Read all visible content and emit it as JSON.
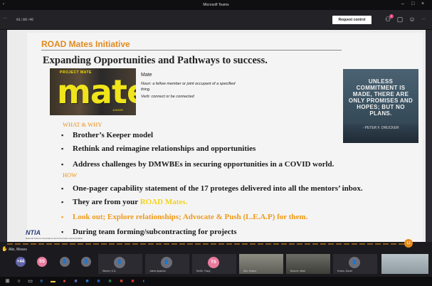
{
  "window": {
    "title": "Microsoft Teams"
  },
  "toolbar": {
    "timer": "01:06:46",
    "request_control": "Request control",
    "badge": "2",
    "more": "···"
  },
  "slide": {
    "header": "ROAD Mates Initiative",
    "heading": "Expanding Opportunities and Pathways to success.",
    "mate_image": {
      "top_text": "PROJECT MATE",
      "word": "mate",
      "bottom_text": "JUNIOR"
    },
    "definition": {
      "term": "Mate",
      "noun": "Noun: a fellow member or joint occupant of a specified thing.",
      "verb": "Verb: connect or be connected"
    },
    "quote": {
      "text": "UNLESS COMMITMENT IS MADE, THERE ARE ONLY PROMISES AND HOPES; BUT NO PLANS.",
      "author": "- PETER F. DRUCKER"
    },
    "what_why_label": "WHAT & WHY",
    "what_why_items": [
      "Brother’s Keeper model",
      "Rethink and reimagine  relationships and opportunities",
      "Address challenges by DMWBEs in securing opportunities in a COVID world."
    ],
    "how_label": "HOW",
    "how_items": {
      "item1": "One-pager capability statement of the 17 proteges delivered into all the mentors’ inbox.",
      "item2_prefix": "They are from your ",
      "item2_highlight": "ROAD Mates.",
      "item3": "Look out; Explore relationships; Advocate & Push (L.E.A.P) for them.",
      "item4": "During team forming/subcontracting for projects"
    },
    "logo": "NTIA",
    "logo_sub": "National Telecommunications and Information Administration",
    "bullet": "▪"
  },
  "presenter_label": "Alio, Moses",
  "page_marker": "12",
  "participants": [
    {
      "label": "+44",
      "initials": "+44",
      "color": "#6264a7"
    },
    {
      "label": "",
      "initials": "SS",
      "color": "#e97b9d"
    },
    {
      "label": "",
      "initials": "👤",
      "color": "#6e6e78"
    },
    {
      "label": "",
      "initials": "👤",
      "color": "#6e6e78"
    },
    {
      "label": "Wesch, K.D.",
      "initials": "👤",
      "color": "#6e6e78"
    },
    {
      "label": "Jaime Aparicio",
      "initials": "👤",
      "color": "#6e6e78"
    },
    {
      "label": "Smith, Tracy",
      "initials": "TS",
      "color": "#e97b9d"
    },
    {
      "label": "Alio, Moses",
      "initials": "",
      "color": ""
    },
    {
      "label": "Bourne, Mark",
      "initials": "",
      "color": ""
    },
    {
      "label": "Evans, David",
      "initials": "👤",
      "color": "#6e6e78"
    }
  ],
  "taskbar": [
    "windows-icon",
    "search-icon",
    "task-view-icon",
    "edge-icon",
    "explorer-icon",
    "chrome-icon",
    "teams-icon",
    "outlook-icon",
    "word-icon",
    "excel-icon",
    "powerpoint-icon",
    "acrobat-icon",
    "edge2-icon"
  ]
}
